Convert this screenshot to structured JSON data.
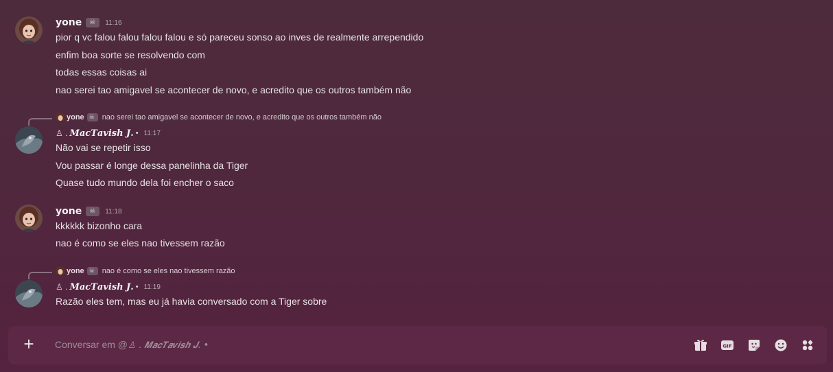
{
  "groups": [
    {
      "author": "yone",
      "badge_icon": "skull-icon",
      "time": "11:16",
      "messages": [
        "pior q vc falou falou falou falou e só pareceu sonso ao inves de realmente arrependido",
        "enfim boa sorte se resolvendo com",
        "todas essas coisas ai",
        "nao serei tao amigavel se acontecer de novo, e acredito que os outros também não"
      ]
    },
    {
      "reply": {
        "author": "yone",
        "text": "nao serei tao amigavel se acontecer de novo, e acredito que os outros também não"
      },
      "author": "𝑴𝒂𝒄𝑻𝒂𝒗𝒊𝒔𝒉 𝑱.",
      "author_prefix": "♙ .",
      "author_suffix": "•",
      "time": "11:17",
      "messages": [
        "Não vai se repetir isso",
        "Vou passar é longe dessa panelinha da Tiger",
        "Quase tudo mundo dela foi encher o saco"
      ]
    },
    {
      "author": "yone",
      "badge_icon": "skull-icon",
      "time": "11:18",
      "messages": [
        "kkkkkk bizonho cara",
        "nao é como se eles nao tivessem razão"
      ]
    },
    {
      "reply": {
        "author": "yone",
        "text": "nao é como se eles nao tivessem razão"
      },
      "author": "𝑴𝒂𝒄𝑻𝒂𝒗𝒊𝒔𝒉 𝑱.",
      "author_prefix": "♙ .",
      "author_suffix": "•",
      "time": "11:19",
      "messages": [
        "Razão eles tem, mas eu já havia conversado com a Tiger sobre"
      ]
    }
  ],
  "composer": {
    "placeholder_prefix": "Conversar em @",
    "placeholder_name": "♙ . 𝑴𝒂𝒄𝑻𝒂𝒗𝒊𝒔𝒉 𝑱. •",
    "tools": [
      "gift-icon",
      "gif-icon",
      "sticker-icon",
      "emoji-icon",
      "apps-icon"
    ],
    "gif_label": "GIF"
  },
  "colors": {
    "background": "#50283d",
    "composer": "#5c2845",
    "text": "#e6e1e4"
  }
}
